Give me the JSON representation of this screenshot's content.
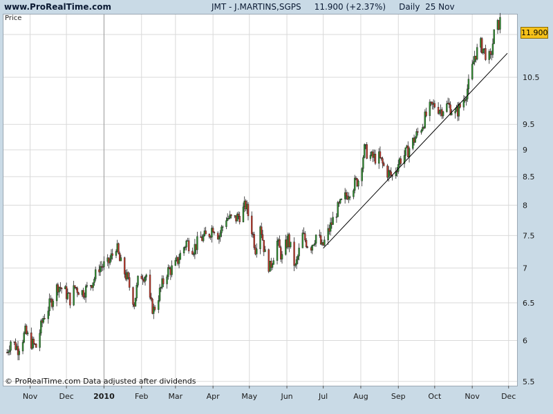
{
  "header": {
    "site": "www.ProRealTime.com",
    "title": "JMT - J.MARTINS,SGPS     11.900 (+2.37%)     Daily  25 Nov"
  },
  "plot_label": "Price",
  "footer": "© ProRealTime.com  Data adjusted after dividends",
  "last_price_tag": "11.900",
  "colors": {
    "up": "#2f8f2f",
    "down": "#c0392b",
    "grid": "#d9d9d9",
    "trendline": "#000000",
    "tag": "#f7c21a"
  },
  "chart_data": {
    "type": "candlestick",
    "yscale": "log",
    "ylim": [
      5.45,
      12.0
    ],
    "y_ticks": [
      "5.5",
      "6",
      "6.5",
      "7",
      "7.5",
      "8",
      "8.5",
      "9",
      "9.5",
      "10.5",
      "11.5"
    ],
    "x_ticks": [
      {
        "label": "Nov",
        "date": "2009-11-01"
      },
      {
        "label": "Dec",
        "date": "2009-12-01"
      },
      {
        "label": "2010",
        "date": "2010-01-01",
        "bold": true
      },
      {
        "label": "Feb",
        "date": "2010-02-01"
      },
      {
        "label": "Mar",
        "date": "2010-03-01"
      },
      {
        "label": "Apr",
        "date": "2010-04-01"
      },
      {
        "label": "May",
        "date": "2010-05-01"
      },
      {
        "label": "Jun",
        "date": "2010-06-01"
      },
      {
        "label": "Jul",
        "date": "2010-07-01"
      },
      {
        "label": "Aug",
        "date": "2010-08-01"
      },
      {
        "label": "Sep",
        "date": "2010-09-01"
      },
      {
        "label": "Oct",
        "date": "2010-10-01"
      },
      {
        "label": "Nov",
        "date": "2010-11-01"
      },
      {
        "label": "Dec",
        "date": "2010-12-01"
      }
    ],
    "year_divider_date": "2010-01-01",
    "trendline": [
      {
        "date": "2010-07-01",
        "y": 7.3
      },
      {
        "date": "2010-11-30",
        "y": 11.05
      }
    ],
    "path_points": [
      {
        "date": "2009-10-13",
        "y": 5.85
      },
      {
        "date": "2009-10-16",
        "y": 6.0
      },
      {
        "date": "2009-10-22",
        "y": 5.9
      },
      {
        "date": "2009-10-28",
        "y": 6.1
      },
      {
        "date": "2009-11-03",
        "y": 5.95
      },
      {
        "date": "2009-11-06",
        "y": 5.92
      },
      {
        "date": "2009-11-12",
        "y": 6.3
      },
      {
        "date": "2009-11-18",
        "y": 6.5
      },
      {
        "date": "2009-11-24",
        "y": 6.75
      },
      {
        "date": "2009-11-30",
        "y": 6.65
      },
      {
        "date": "2009-12-04",
        "y": 6.55
      },
      {
        "date": "2009-12-08",
        "y": 6.72
      },
      {
        "date": "2009-12-14",
        "y": 6.65
      },
      {
        "date": "2009-12-18",
        "y": 6.7
      },
      {
        "date": "2009-12-24",
        "y": 6.85
      },
      {
        "date": "2009-12-28",
        "y": 7.02
      },
      {
        "date": "2010-01-04",
        "y": 7.05
      },
      {
        "date": "2010-01-08",
        "y": 7.2
      },
      {
        "date": "2010-01-11",
        "y": 7.35
      },
      {
        "date": "2010-01-14",
        "y": 7.1
      },
      {
        "date": "2010-01-20",
        "y": 6.85
      },
      {
        "date": "2010-01-26",
        "y": 6.5
      },
      {
        "date": "2010-01-30",
        "y": 6.9
      },
      {
        "date": "2010-02-05",
        "y": 6.9
      },
      {
        "date": "2010-02-08",
        "y": 6.5
      },
      {
        "date": "2010-02-11",
        "y": 6.4
      },
      {
        "date": "2010-02-16",
        "y": 6.65
      },
      {
        "date": "2010-02-22",
        "y": 6.95
      },
      {
        "date": "2010-02-28",
        "y": 7.0
      },
      {
        "date": "2010-03-05",
        "y": 7.2
      },
      {
        "date": "2010-03-10",
        "y": 7.4
      },
      {
        "date": "2010-03-16",
        "y": 7.3
      },
      {
        "date": "2010-03-22",
        "y": 7.45
      },
      {
        "date": "2010-03-28",
        "y": 7.5
      },
      {
        "date": "2010-04-01",
        "y": 7.65
      },
      {
        "date": "2010-04-06",
        "y": 7.5
      },
      {
        "date": "2010-04-12",
        "y": 7.8
      },
      {
        "date": "2010-04-18",
        "y": 7.75
      },
      {
        "date": "2010-04-24",
        "y": 7.85
      },
      {
        "date": "2010-04-28",
        "y": 8.0
      },
      {
        "date": "2010-05-03",
        "y": 7.6
      },
      {
        "date": "2010-05-06",
        "y": 7.3
      },
      {
        "date": "2010-05-10",
        "y": 7.7
      },
      {
        "date": "2010-05-14",
        "y": 7.2
      },
      {
        "date": "2010-05-18",
        "y": 7.0
      },
      {
        "date": "2010-05-24",
        "y": 7.4
      },
      {
        "date": "2010-05-28",
        "y": 7.15
      },
      {
        "date": "2010-06-02",
        "y": 7.45
      },
      {
        "date": "2010-06-08",
        "y": 7.0
      },
      {
        "date": "2010-06-14",
        "y": 7.5
      },
      {
        "date": "2010-06-20",
        "y": 7.3
      },
      {
        "date": "2010-06-26",
        "y": 7.55
      },
      {
        "date": "2010-06-30",
        "y": 7.3
      },
      {
        "date": "2010-07-06",
        "y": 7.6
      },
      {
        "date": "2010-07-12",
        "y": 7.9
      },
      {
        "date": "2010-07-18",
        "y": 8.1
      },
      {
        "date": "2010-07-24",
        "y": 8.3
      },
      {
        "date": "2010-07-30",
        "y": 8.45
      },
      {
        "date": "2010-08-04",
        "y": 9.0
      },
      {
        "date": "2010-08-10",
        "y": 8.85
      },
      {
        "date": "2010-08-16",
        "y": 8.85
      },
      {
        "date": "2010-08-22",
        "y": 8.6
      },
      {
        "date": "2010-08-27",
        "y": 8.5
      },
      {
        "date": "2010-09-02",
        "y": 8.8
      },
      {
        "date": "2010-09-08",
        "y": 8.95
      },
      {
        "date": "2010-09-14",
        "y": 9.2
      },
      {
        "date": "2010-09-20",
        "y": 9.45
      },
      {
        "date": "2010-09-26",
        "y": 9.8
      },
      {
        "date": "2010-10-01",
        "y": 9.9
      },
      {
        "date": "2010-10-06",
        "y": 9.8
      },
      {
        "date": "2010-10-12",
        "y": 9.9
      },
      {
        "date": "2010-10-18",
        "y": 9.7
      },
      {
        "date": "2010-10-24",
        "y": 9.95
      },
      {
        "date": "2010-10-30",
        "y": 10.4
      },
      {
        "date": "2010-11-03",
        "y": 11.0
      },
      {
        "date": "2010-11-08",
        "y": 11.25
      },
      {
        "date": "2010-11-12",
        "y": 11.05
      },
      {
        "date": "2010-11-16",
        "y": 10.9
      },
      {
        "date": "2010-11-19",
        "y": 11.5
      },
      {
        "date": "2010-11-22",
        "y": 11.7
      },
      {
        "date": "2010-11-25",
        "y": 11.9
      }
    ]
  }
}
